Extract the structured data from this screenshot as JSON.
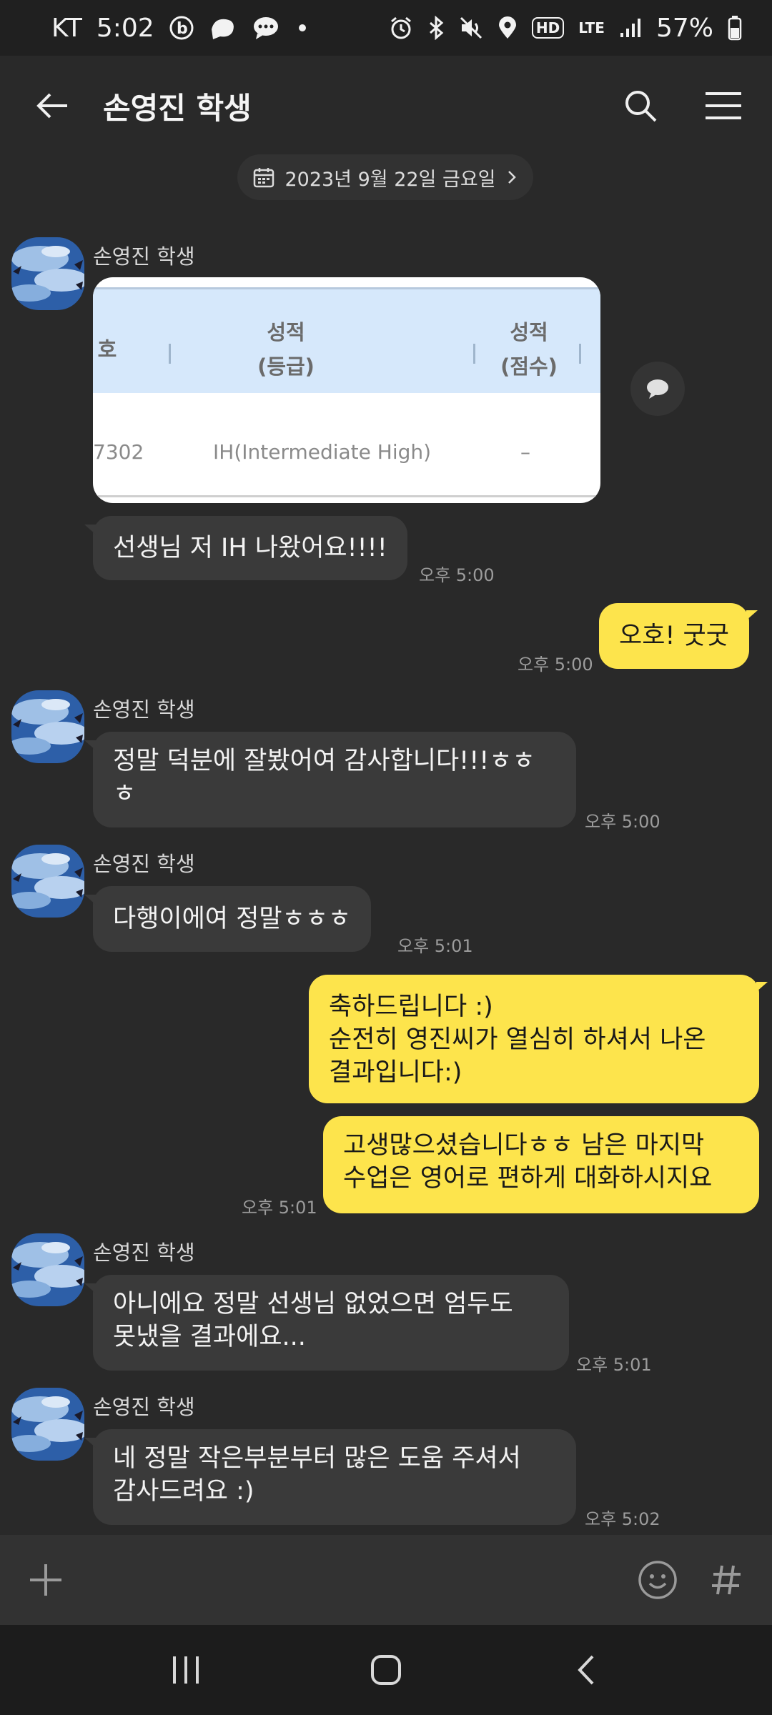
{
  "status_bar": {
    "carrier": "KT",
    "time": "5:02",
    "hd_label": "HD",
    "lte_label": "LTE",
    "battery": "57%"
  },
  "header": {
    "title": "손영진 학생"
  },
  "date_pill": {
    "label": "2023년 9월 22일 금요일"
  },
  "image_attachment": {
    "col_partial": "호",
    "col1": "성적\n(등급)",
    "col2": "성적\n(점수)",
    "cell_partial": "7302",
    "cell_grade": "IH(Intermediate High)",
    "cell_score": "–"
  },
  "messages": [
    {
      "sender": "손영진 학생",
      "text": "선생님 저 IH 나왔어요!!!!",
      "time": "오후 5:00"
    },
    {
      "text": "오호!  굿굿",
      "time": "오후 5:00"
    },
    {
      "sender": "손영진 학생",
      "text": "정말 덕분에 잘봤어여 감사합니다!!!ㅎㅎ\nㅎ",
      "time": "오후 5:00"
    },
    {
      "sender": "손영진 학생",
      "text": "다행이에여 정말ㅎㅎㅎ",
      "time": "오후 5:01"
    },
    {
      "text": "축하드립니다 :)\n순전히 영진씨가 열심히 하셔서 나온\n결과입니다:)"
    },
    {
      "text": "고생많으셨습니다ㅎㅎ 남은 마지막\n수업은 영어로 편하게 대화하시지요",
      "time": "오후 5:01"
    },
    {
      "sender": "손영진 학생",
      "text": "아니에요 정말 선생님 없었으면 엄두도\n못냈을 결과에요...",
      "time": "오후 5:01"
    },
    {
      "sender": "손영진 학생",
      "text": "네 정말 작은부분부터 많은 도움 주셔서\n감사드려요 :)",
      "time": "오후 5:02"
    }
  ],
  "input_bar": {
    "placeholder": ""
  },
  "colors": {
    "background": "#292929",
    "incoming_bubble": "#3a3a3a",
    "outgoing_bubble": "#fde44c"
  },
  "icons": {
    "back": "arrow-left-icon",
    "search": "search-icon",
    "menu": "hamburger-menu-icon",
    "calendar": "calendar-icon",
    "add": "plus-icon",
    "emoji": "emoji-icon",
    "hashtag": "hashtag-icon"
  }
}
